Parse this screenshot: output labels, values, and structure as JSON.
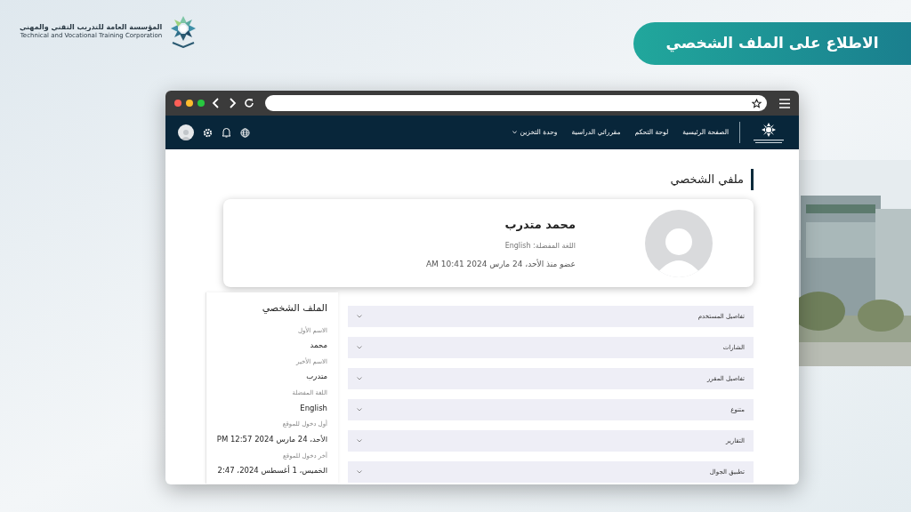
{
  "slide_title": "الاطلاع على الملف الشخصي",
  "org_logo": {
    "name_ar": "المؤسسة العامة للتدريب التقني والمهني",
    "name_en": "Technical and Vocational Training Corporation"
  },
  "nav": {
    "items": [
      {
        "label": "الصفحة الرئيسية",
        "kind": "link"
      },
      {
        "label": "لوحة التحكم",
        "kind": "link"
      },
      {
        "label": "مقرراتي الدراسية",
        "kind": "link"
      },
      {
        "label": "وحدة التخزين",
        "kind": "menu"
      }
    ]
  },
  "page_title": "ملفي الشخصي",
  "profile_card": {
    "name": "محمد متدرب",
    "language": "اللغة المفضلة: English",
    "member_since": "عضو منذ الأحد، 24 مارس 2024 10:41 AM"
  },
  "details": {
    "title": "الملف الشخصي",
    "fields": [
      {
        "label": "الاسم الأول",
        "value": "محمد"
      },
      {
        "label": "الاسم الأخير",
        "value": "متدرب"
      },
      {
        "label": "اللغة المفضلة",
        "value": "English"
      },
      {
        "label": "أول دخول للموقع",
        "value": "الأحد، 24 مارس 2024 12:57 PM"
      },
      {
        "label": "آخر دخول للموقع",
        "value": "الخميس، 1 أغسطس 2024، 2:47"
      }
    ]
  },
  "sections": [
    {
      "label": "تفاصيل المستخدم",
      "expanded": false
    },
    {
      "label": "الشارات",
      "expanded": false
    },
    {
      "label": "تفاصيل المقرر",
      "expanded": false
    },
    {
      "label": "متنوع",
      "expanded": false
    },
    {
      "label": "التقارير",
      "expanded": false
    },
    {
      "label": "تطبيق الجوال",
      "expanded": false
    }
  ]
}
